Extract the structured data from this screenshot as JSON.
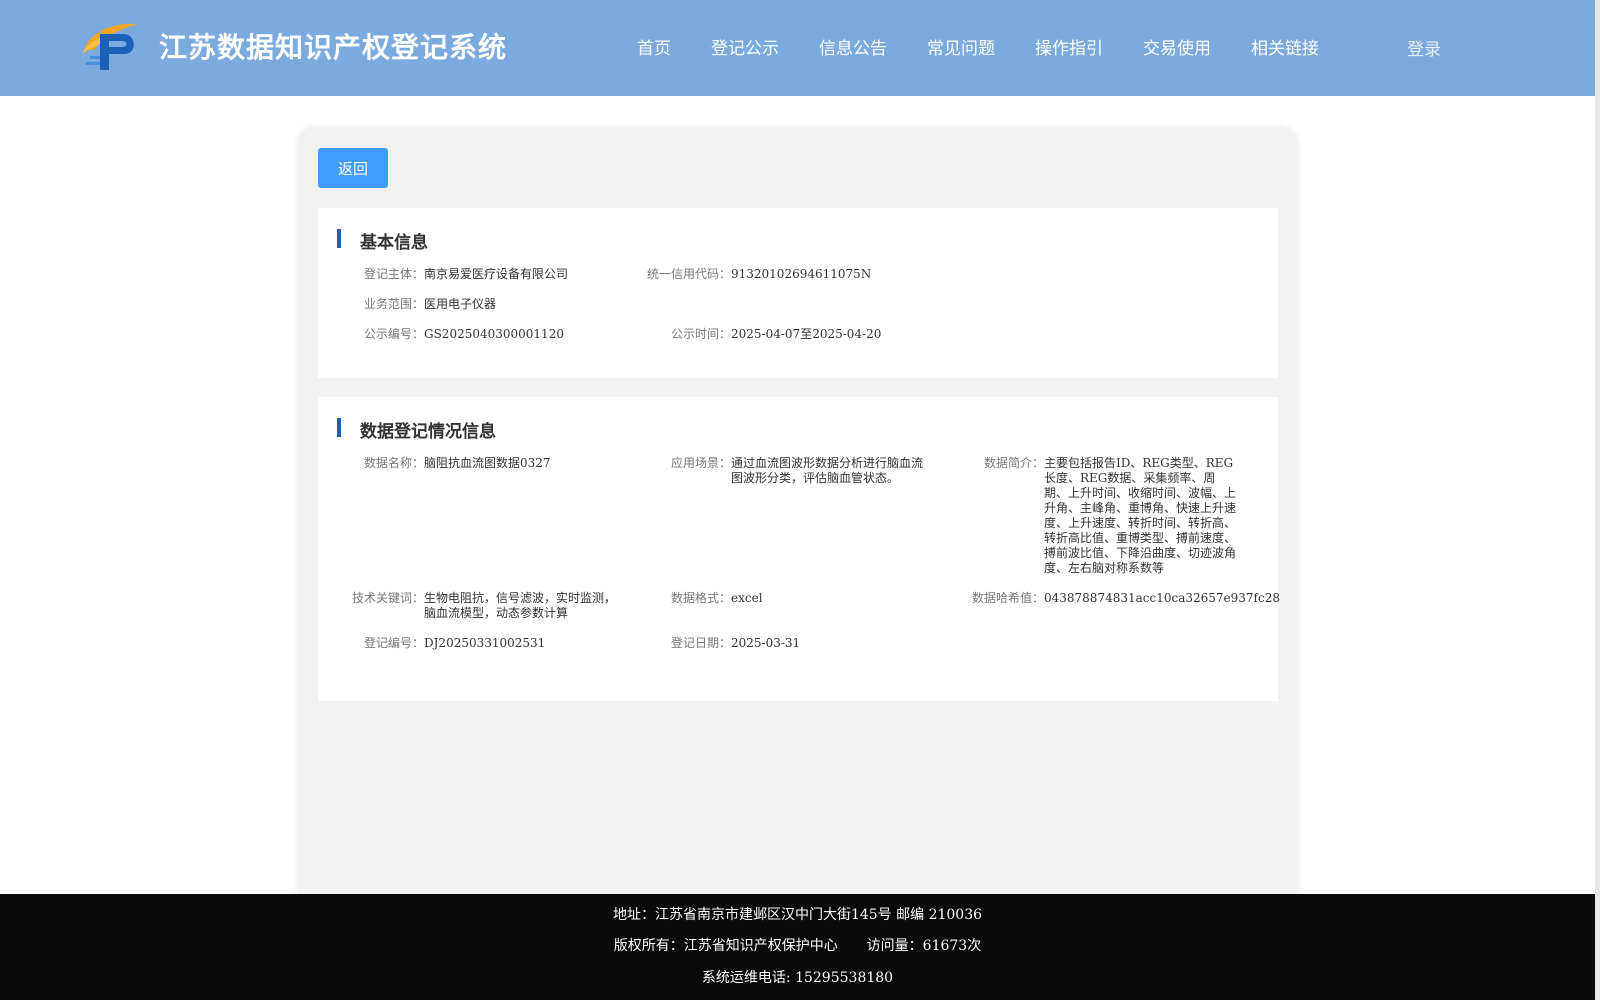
{
  "header": {
    "site_title": "江苏数据知识产权登记系统",
    "nav": [
      "首页",
      "登记公示",
      "信息公告",
      "常见问题",
      "操作指引",
      "交易使用",
      "相关链接"
    ],
    "login": "登录"
  },
  "toolbar": {
    "back_label": "返回"
  },
  "basic_info": {
    "title": "基本信息",
    "subject_label": "登记主体：",
    "subject": "南京易爱医疗设备有限公司",
    "credit_code_label": "统一信用代码：",
    "credit_code": "91320102694611075N",
    "scope_label": "业务范围：",
    "scope": "医用电子仪器",
    "pub_no_label": "公示编号：",
    "pub_no": "GS2025040300001120",
    "pub_time_label": "公示时间：",
    "pub_time": "2025-04-07至2025-04-20"
  },
  "registration_info": {
    "title": "数据登记情况信息",
    "data_name_label": "数据名称：",
    "data_name": "脑阻抗血流图数据0327",
    "scenario_label": "应用场景：",
    "scenario": "通过血流图波形数据分析进行脑血流图波形分类，评估脑血管状态。",
    "summary_label": "数据简介：",
    "summary": "主要包括报告ID、REG类型、REG长度、REG数据、采集频率、周期、上升时间、收缩时间、波幅、上升角、主峰角、重博角、快速上升速度、上升速度、转折时间、转折高、转折高比值、重博类型、搏前速度、搏前波比值、下降沿曲度、切迹波角度、左右脑对称系数等",
    "keywords_label": "技术关键词：",
    "keywords": "生物电阻抗，信号滤波，实时监测，脑血流模型，动态参数计算",
    "format_label": "数据格式：",
    "format": "excel",
    "hash_label": "数据哈希值：",
    "hash": "043878874831acc10ca32657e937fc28",
    "reg_no_label": "登记编号：",
    "reg_no": "DJ20250331002531",
    "reg_date_label": "登记日期：",
    "reg_date": "2025-03-31"
  },
  "footer": {
    "address": "地址：江苏省南京市建邺区汉中门大街145号 邮编 210036",
    "copyright": "版权所有：江苏省知识产权保护中心",
    "visits": "访问量：61673次",
    "hotline": "系统运维电话: 15295538180"
  },
  "colors": {
    "header_bg": "#7aaade",
    "button_primary": "#409eff",
    "title_bar": "#1d5fb6",
    "footer_bg": "#0a0a0a"
  }
}
